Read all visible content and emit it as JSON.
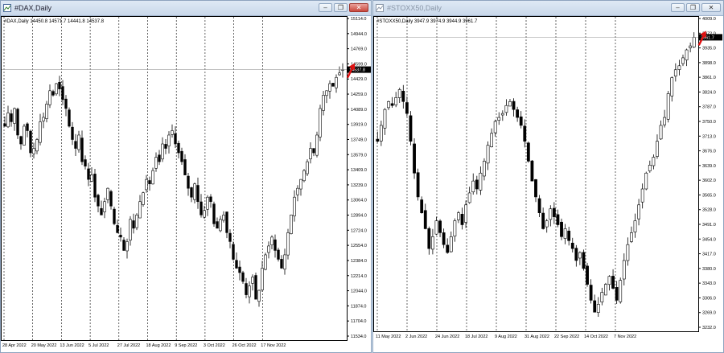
{
  "dax": {
    "window_title": "#DAX,Daily",
    "header": "#DAX,Daily",
    "ohlc": "14450.8 14571.7 14441.8 14537.8",
    "current_price": "14537.8",
    "y_ticks": [
      "15114.0",
      "14944.0",
      "14769.0",
      "14599.0",
      "14429.0",
      "14259.0",
      "14089.0",
      "13919.0",
      "13749.0",
      "13579.0",
      "13409.0",
      "13239.0",
      "13064.0",
      "12894.0",
      "12724.0",
      "12554.0",
      "12384.0",
      "12214.0",
      "12044.0",
      "11874.0",
      "11704.0",
      "11534.0"
    ],
    "x_labels": [
      "28 Apr 2022",
      "20 May 2022",
      "13 Jun 2022",
      "5 Jul 2022",
      "27 Jul 2022",
      "18 Aug 2022",
      "9 Sep 2022",
      "3 Oct 2022",
      "26 Oct 2022",
      "17 Nov 2022"
    ]
  },
  "stoxx": {
    "window_title": "#STOXX50,Daily",
    "header": "#STOXX50,Daily",
    "ohlc": "3947.9 3974.9 3944.9 3961.7",
    "current_price": "3961.7",
    "y_ticks": [
      "4009.0",
      "3972.0",
      "3935.0",
      "3898.0",
      "3861.0",
      "3824.0",
      "3787.0",
      "3750.0",
      "3713.0",
      "3676.0",
      "3639.0",
      "3602.0",
      "3565.0",
      "3528.0",
      "3491.0",
      "3454.0",
      "3417.0",
      "3380.0",
      "3343.0",
      "3306.0",
      "3269.0",
      "3232.0"
    ],
    "x_labels": [
      "11 May 2022",
      "2 Jun 2022",
      "24 Jun 2022",
      "18 Jul 2022",
      "9 Aug 2022",
      "31 Aug 2022",
      "22 Sep 2022",
      "14 Oct 2022",
      "7 Nov 2022"
    ]
  },
  "colors": {
    "candle": "#000000",
    "arrow": "#e01010",
    "price_label_bg": "#000000",
    "grid": "#000000"
  },
  "chart_data": [
    {
      "type": "candlestick",
      "title": "#DAX,Daily",
      "ylim": [
        11534,
        15114
      ],
      "x_ticks": [
        "28 Apr 2022",
        "20 May 2022",
        "13 Jun 2022",
        "5 Jul 2022",
        "27 Jul 2022",
        "18 Aug 2022",
        "9 Sep 2022",
        "3 Oct 2022",
        "26 Oct 2022",
        "17 Nov 2022"
      ],
      "close": [
        13900,
        14050,
        13950,
        14100,
        13800,
        13700,
        13900,
        13850,
        13600,
        13650,
        13750,
        13950,
        14000,
        14150,
        14300,
        14250,
        14380,
        14320,
        14200,
        14100,
        13900,
        13750,
        13650,
        13800,
        13500,
        13450,
        13300,
        13350,
        13100,
        13000,
        12900,
        13050,
        13200,
        13000,
        12800,
        12700,
        12650,
        12500,
        12600,
        12850,
        12750,
        12900,
        13050,
        13150,
        13300,
        13250,
        13400,
        13550,
        13500,
        13700,
        13650,
        13800,
        13850,
        13700,
        13600,
        13500,
        13350,
        13200,
        13100,
        13250,
        13050,
        12900,
        12950,
        13100,
        13050,
        12800,
        12750,
        12850,
        12900,
        12700,
        12600,
        12400,
        12300,
        12250,
        12150,
        12000,
        12100,
        12200,
        11950,
        12050,
        12300,
        12450,
        12550,
        12650,
        12500,
        12400,
        12300,
        12450,
        12700,
        12900,
        13100,
        13200,
        13300,
        13400,
        13500,
        13650,
        13600,
        13800,
        14100,
        14250,
        14300,
        14380,
        14350,
        14450,
        14500,
        14537.8
      ]
    },
    {
      "type": "candlestick",
      "title": "#STOXX50,Daily",
      "ylim": [
        3232,
        4009
      ],
      "x_ticks": [
        "11 May 2022",
        "2 Jun 2022",
        "24 Jun 2022",
        "18 Jul 2022",
        "9 Aug 2022",
        "31 Aug 2022",
        "22 Sep 2022",
        "14 Oct 2022",
        "7 Nov 2022"
      ],
      "close": [
        3700,
        3740,
        3780,
        3800,
        3790,
        3810,
        3830,
        3800,
        3770,
        3700,
        3620,
        3560,
        3520,
        3480,
        3430,
        3460,
        3500,
        3470,
        3440,
        3420,
        3460,
        3500,
        3520,
        3490,
        3540,
        3570,
        3600,
        3580,
        3620,
        3650,
        3690,
        3720,
        3750,
        3760,
        3770,
        3790,
        3800,
        3780,
        3760,
        3740,
        3700,
        3650,
        3600,
        3560,
        3520,
        3480,
        3500,
        3530,
        3510,
        3490,
        3460,
        3480,
        3450,
        3430,
        3400,
        3420,
        3380,
        3340,
        3300,
        3270,
        3290,
        3320,
        3340,
        3360,
        3330,
        3300,
        3350,
        3400,
        3440,
        3470,
        3500,
        3540,
        3580,
        3620,
        3640,
        3660,
        3700,
        3740,
        3760,
        3820,
        3860,
        3880,
        3890,
        3910,
        3930,
        3940,
        3961.7
      ]
    }
  ]
}
